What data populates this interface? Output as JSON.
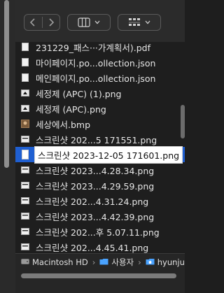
{
  "toolbar": {
    "back_icon": "chevron-left-icon",
    "forward_icon": "chevron-right-icon",
    "view_icon": "columns-view-icon",
    "group_icon": "grid-group-icon"
  },
  "files": [
    {
      "name": "231229_패스···가계획서).pdf",
      "icon": "pdf-icon"
    },
    {
      "name": "마이페이지.po...ollection.json",
      "icon": "json-icon"
    },
    {
      "name": "메인페이지.po...ollection.json",
      "icon": "json-icon"
    },
    {
      "name": "세정제 (APC) (1).png",
      "icon": "image-icon"
    },
    {
      "name": "세정제 (APC).png",
      "icon": "image-icon"
    },
    {
      "name": "세상에서.bmp",
      "icon": "bmp-icon"
    },
    {
      "name": "스크린샷 202...5 171551.png",
      "icon": "screenshot-icon"
    },
    {
      "name": "스크린샷 2023-12-05 171601.png",
      "icon": "screenshot-icon",
      "selected": true
    },
    {
      "name": "스크린샷 2023...4.28.34.png",
      "icon": "screenshot-icon"
    },
    {
      "name": "스크린샷 2023...4.29.59.png",
      "icon": "screenshot-icon"
    },
    {
      "name": "스크린샷 202...4.31.24.png",
      "icon": "screenshot-icon"
    },
    {
      "name": "스크린샷 2023...4.42.39.png",
      "icon": "screenshot-icon"
    },
    {
      "name": "스크린샷 202...후 5.07.11.png",
      "icon": "screenshot-icon"
    },
    {
      "name": "스크린샷 202...4.45.41.png",
      "icon": "screenshot-icon"
    }
  ],
  "pathbar": {
    "items": [
      "Macintosh HD",
      "사용자",
      "hyunjun"
    ],
    "separator": "›"
  },
  "colors": {
    "selection": "#1f5fd1",
    "folder": "#4aa3ff"
  }
}
